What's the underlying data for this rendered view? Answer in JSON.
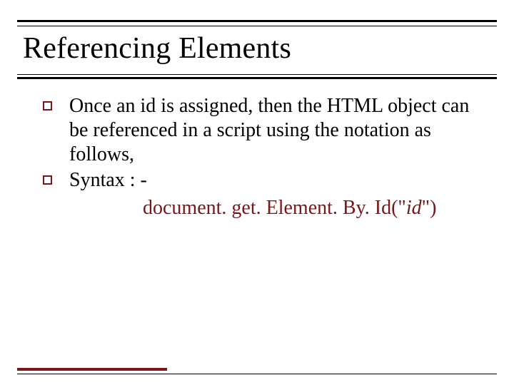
{
  "title": "Referencing Elements",
  "bullets": [
    "Once an id is assigned, then the HTML object can be referenced in a script using the notation as follows,",
    "Syntax : -"
  ],
  "syntax": {
    "prefix": "document. get. Element. By. Id(\"",
    "id": "id",
    "suffix": "\")"
  },
  "colors": {
    "accent": "#7a1616"
  }
}
